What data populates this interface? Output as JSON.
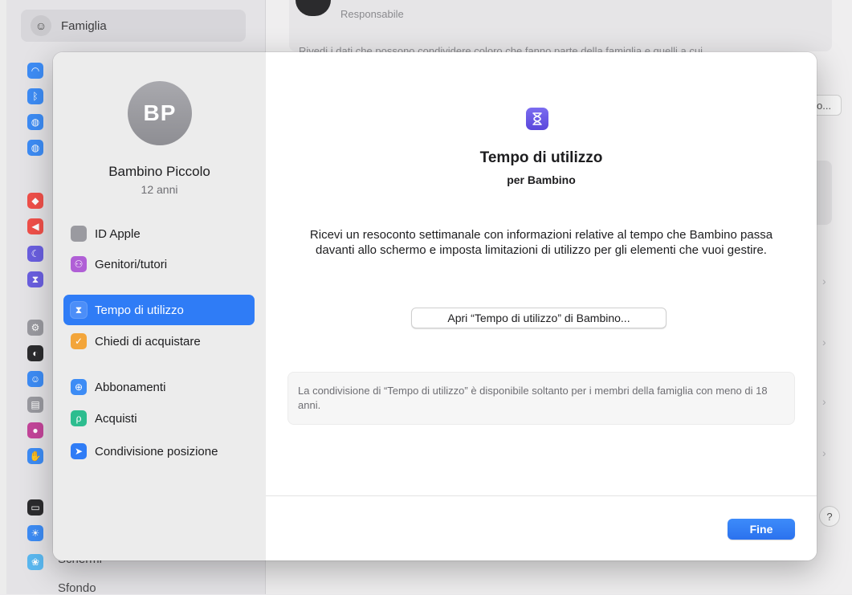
{
  "background": {
    "family_label": "Famiglia",
    "responsible_label": "Responsabile",
    "description_fragment": "Rivedi i dati che possono condividere coloro che fanno parte della famiglia e quelli a cui",
    "button_fragment": "o...",
    "bottom_items": [
      "Schermi",
      "Sfondo"
    ],
    "help_label": "?",
    "sidebar_icons": [
      {
        "name": "wifi-icon",
        "color": "#3d8cf5",
        "glyph": "◠"
      },
      {
        "name": "bluetooth-icon",
        "color": "#3d8cf5",
        "glyph": "ᛒ"
      },
      {
        "name": "network-icon",
        "color": "#3d8cf5",
        "glyph": "◍"
      },
      {
        "name": "vpn-globe-icon",
        "color": "#3d8cf5",
        "glyph": "◍"
      },
      {
        "name": "notifications-icon",
        "color": "#f0504a",
        "glyph": "◆"
      },
      {
        "name": "sound-icon",
        "color": "#f0504a",
        "glyph": "◀"
      },
      {
        "name": "focus-moon-icon",
        "color": "#6a5fe0",
        "glyph": "☾"
      },
      {
        "name": "screen-time-icon",
        "color": "#6a5fe0",
        "glyph": "⧗"
      },
      {
        "name": "general-gear-icon",
        "color": "#9a9aa0",
        "glyph": "⚙"
      },
      {
        "name": "appearance-icon",
        "color": "#2c2c2e",
        "glyph": "◐"
      },
      {
        "name": "accessibility-icon",
        "color": "#3d8cf5",
        "glyph": "☺"
      },
      {
        "name": "control-center-icon",
        "color": "#9a9aa0",
        "glyph": "▤"
      },
      {
        "name": "siri-icon",
        "color": "#c4459a",
        "glyph": "●"
      },
      {
        "name": "privacy-hand-icon",
        "color": "#3d8cf5",
        "glyph": "✋"
      },
      {
        "name": "desktop-dock-icon",
        "color": "#2c2c2e",
        "glyph": "▭"
      },
      {
        "name": "displays-icon",
        "color": "#3d8cf5",
        "glyph": "☀"
      },
      {
        "name": "wallpaper-icon",
        "color": "#5ab8f0",
        "glyph": "❀"
      }
    ]
  },
  "member": {
    "initials": "BP",
    "name": "Bambino Piccolo",
    "age": "12 anni"
  },
  "nav": [
    {
      "id": "apple-id",
      "label": "ID Apple",
      "icon": "apple-icon",
      "color": "#9a9aa0",
      "glyph": "",
      "active": false
    },
    {
      "id": "parents",
      "label": "Genitori/tutori",
      "icon": "parents-icon",
      "color": "#b05fd6",
      "glyph": "⚇",
      "active": false
    },
    {
      "id": "screen-time",
      "label": "Tempo di utilizzo",
      "icon": "hourglass-icon",
      "color": "#6a5fe0",
      "glyph": "⧗",
      "active": true
    },
    {
      "id": "ask-to-buy",
      "label": "Chiedi di acquistare",
      "icon": "ask-to-buy-icon",
      "color": "#f3a53a",
      "glyph": "✓",
      "active": false
    },
    {
      "id": "subscriptions",
      "label": "Abbonamenti",
      "icon": "subscriptions-icon",
      "color": "#3d8cf5",
      "glyph": "⊕",
      "active": false
    },
    {
      "id": "purchases",
      "label": "Acquisti",
      "icon": "purchases-icon",
      "color": "#2dbd8f",
      "glyph": "ρ",
      "active": false
    },
    {
      "id": "location",
      "label": "Condivisione posizione",
      "icon": "location-arrow-icon",
      "color": "#2f7cf6",
      "glyph": "➤",
      "active": false
    }
  ],
  "main": {
    "title": "Tempo di utilizzo",
    "subtitle": "per Bambino",
    "description": "Ricevi un resoconto settimanale con informazioni relative al tempo che Bambino passa davanti allo schermo e imposta limitazioni di utilizzo per gli elementi che vuoi gestire.",
    "open_button": "Apri “Tempo di utilizzo” di Bambino...",
    "note": "La condivisione di “Tempo di utilizzo” è disponibile soltanto per i membri della famiglia con meno di 18 anni.",
    "done_button": "Fine"
  }
}
